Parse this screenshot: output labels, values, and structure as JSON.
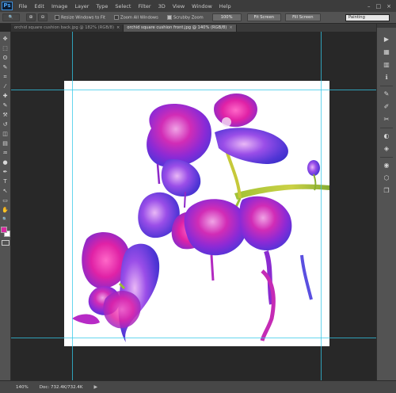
{
  "app": {
    "logo": "Ps"
  },
  "menu": [
    "File",
    "Edit",
    "Image",
    "Layer",
    "Type",
    "Select",
    "Filter",
    "3D",
    "View",
    "Window",
    "Help"
  ],
  "window_controls": [
    "–",
    "□",
    "×"
  ],
  "options": {
    "zoom_tool_icon": "🔍",
    "zoom_in": "⊕",
    "zoom_out": "⊖",
    "resize_windows": "Resize Windows to Fit",
    "zoom_all_windows": "Zoom All Windows",
    "scrubby_zoom": "Scrubby Zoom",
    "btn_100": "100%",
    "btn_fit": "Fit Screen",
    "btn_fill": "Fill Screen",
    "workspace": "Painting"
  },
  "tabs": [
    {
      "label": "orchid square cushion back.jpg @ 182% (RGB/8)",
      "close": "×"
    },
    {
      "label": "orchid square cushion front.jpg @ 140% (RGB/8)",
      "close": "×"
    }
  ],
  "toolbar_icons": [
    "move-icon",
    "marquee-icon",
    "lasso-icon",
    "quick-select-icon",
    "crop-icon",
    "eyedropper-icon",
    "healing-brush-icon",
    "brush-icon",
    "clone-stamp-icon",
    "history-brush-icon",
    "eraser-icon",
    "gradient-icon",
    "blur-icon",
    "dodge-icon",
    "pen-icon",
    "type-icon",
    "path-selection-icon",
    "rectangle-icon",
    "hand-icon",
    "zoom-icon"
  ],
  "toolbar_glyphs": [
    "✥",
    "⬚",
    "ʘ",
    "✎",
    "⌗",
    "⁄",
    "✚",
    "✎",
    "⚒",
    "↺",
    "◫",
    "▤",
    "♒",
    "●",
    "✒",
    "T",
    "↖",
    "▭",
    "✋",
    "🔍"
  ],
  "colors": {
    "foreground": "#d82aa0",
    "background": "#ffffff"
  },
  "right_panel_icons": [
    "history-icon",
    "color-icon",
    "swatches-icon",
    "info-icon",
    "brush-presets-icon",
    "brush-icon",
    "clone-source-icon",
    "adjustments-icon",
    "styles-icon",
    "channels-icon",
    "paths-icon",
    "layers-icon"
  ],
  "right_panel_glyphs": [
    "▶",
    "▦",
    "▥",
    "ℹ",
    "✎",
    "✐",
    "✂",
    "◐",
    "◈",
    "◉",
    "⬡",
    "❐"
  ],
  "status": {
    "zoom": "140%",
    "doc": "Doc: 732.4K/732.4K",
    "arrow": "▶"
  }
}
